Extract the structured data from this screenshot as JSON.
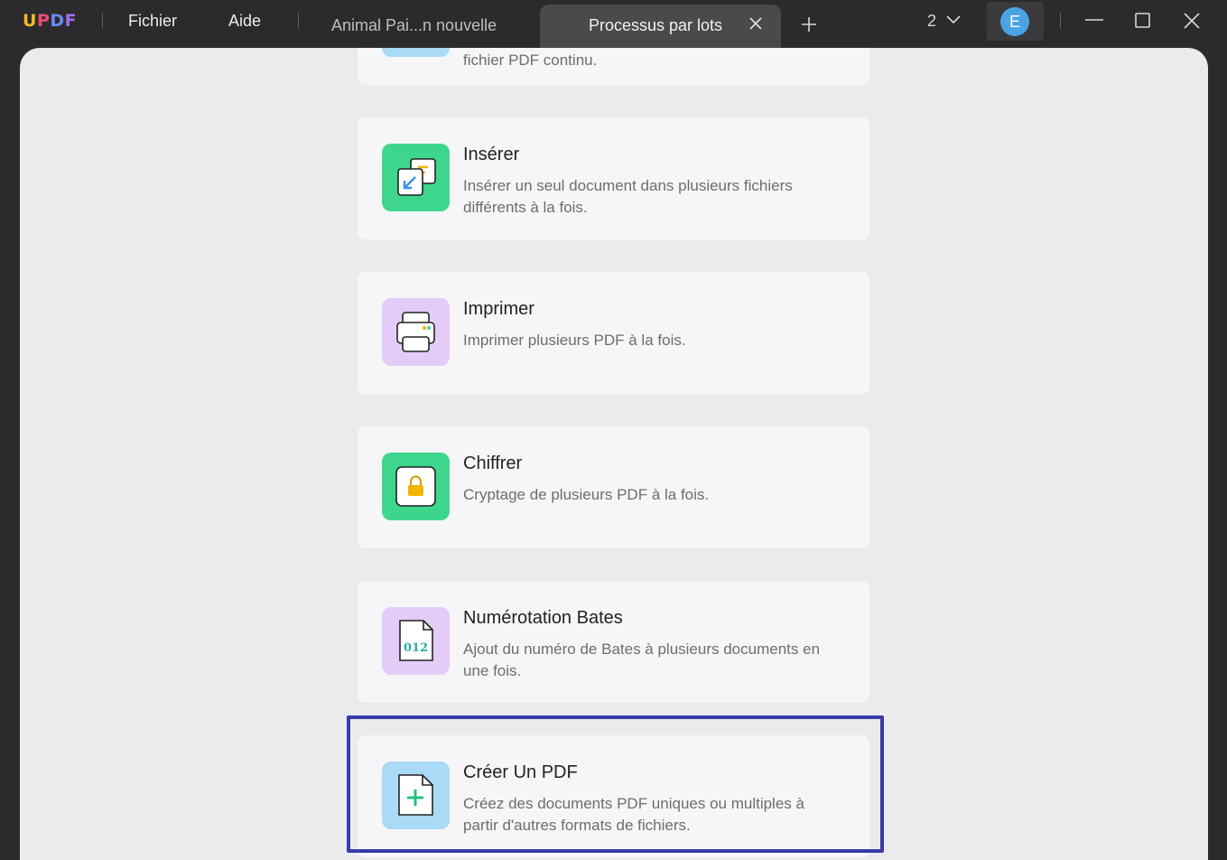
{
  "app": {
    "logo": {
      "u": "U",
      "p": "P",
      "d": "D",
      "f": "F"
    }
  },
  "menu": {
    "file": "Fichier",
    "help": "Aide"
  },
  "tabs": {
    "inactive_label": "Animal Pai...n nouvelle",
    "active_label": "Processus par lots"
  },
  "toolbar": {
    "open_count": "2",
    "avatar_letter": "E"
  },
  "cards": [
    {
      "title": "",
      "desc": "fichier PDF continu."
    },
    {
      "title": "Insérer",
      "desc": "Insérer un seul document dans plusieurs fichiers différents à la fois."
    },
    {
      "title": "Imprimer",
      "desc": "Imprimer plusieurs PDF à la fois."
    },
    {
      "title": "Chiffrer",
      "desc": "Cryptage de plusieurs PDF à la fois."
    },
    {
      "title": "Numérotation Bates",
      "desc": "Ajout du numéro de Bates à plusieurs documents en une fois.",
      "icon_text": "012"
    },
    {
      "title": "Créer Un PDF",
      "desc": "Créez des documents PDF uniques ou multiples à partir d'autres formats de fichiers."
    }
  ],
  "colors": {
    "insert_icon_bg": "#3dd68c",
    "print_icon_bg": "#e3cdf8",
    "encrypt_icon_bg": "#3dd68c",
    "bates_icon_bg": "#e3cdf8",
    "create_icon_bg": "#a9daf6",
    "highlight_border": "#3a3aaa"
  }
}
